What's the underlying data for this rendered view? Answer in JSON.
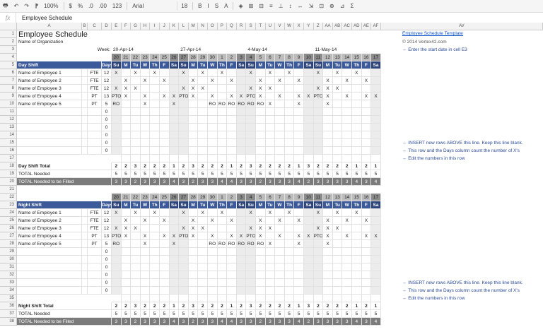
{
  "toolbar": {
    "items": [
      "🖶",
      "↶",
      "↷",
      "⁋",
      "100%",
      "$",
      "%",
      ".0",
      ".00",
      "123",
      "Arial",
      "18",
      "B",
      "I",
      "S",
      "A",
      "◈",
      "⊞",
      "⊟",
      "≡",
      "⊥",
      "↕",
      "↔",
      "⇲",
      "⊡",
      "⊕",
      "⊿",
      "Σ"
    ],
    "zoom": "100%",
    "font": "Arial",
    "font_size": "18"
  },
  "formula": {
    "fx": "fx",
    "value": "Employee Schedule"
  },
  "columns": [
    "A",
    "B",
    "C",
    "D",
    "E",
    "F",
    "G",
    "H",
    "I",
    "J",
    "K",
    "L",
    "M",
    "N",
    "O",
    "P",
    "Q",
    "R",
    "S",
    "T",
    "U",
    "V",
    "W",
    "X",
    "Y",
    "Z",
    "AA",
    "AB",
    "AC",
    "AD",
    "AE",
    "AF",
    "AV"
  ],
  "title": "Employee Schedule",
  "org": "Name of Organization",
  "week_label": "Week:",
  "weeks": [
    "20-Apr-14",
    "27-Apr-14",
    "4-May-14",
    "11-May-14"
  ],
  "dates": [
    "20",
    "21",
    "22",
    "23",
    "24",
    "25",
    "26",
    "27",
    "28",
    "29",
    "30",
    "1",
    "2",
    "3",
    "4",
    "5",
    "6",
    "7",
    "8",
    "9",
    "10",
    "11",
    "12",
    "13",
    "14",
    "15",
    "16",
    "17"
  ],
  "days": [
    "Su",
    "M",
    "Tu",
    "W",
    "Th",
    "F",
    "Sa",
    "Su",
    "M",
    "Tu",
    "W",
    "Th",
    "F",
    "Sa",
    "Su",
    "M",
    "Tu",
    "W",
    "Th",
    "F",
    "Sa",
    "Su",
    "M",
    "Tu",
    "W",
    "Th",
    "F",
    "Sa"
  ],
  "day_shift": {
    "label": "Day Shift",
    "days_hdr": "Days",
    "employees": [
      {
        "name": "Name of Employee 1",
        "type": "FTE",
        "days": "12",
        "marks": [
          "X",
          "",
          "X",
          "",
          "X",
          "",
          "",
          "X",
          "",
          "X",
          "",
          "X",
          "",
          "",
          "X",
          "",
          "X",
          "",
          "X",
          "",
          "",
          "X",
          "",
          "X",
          "",
          "X",
          "",
          ""
        ]
      },
      {
        "name": "Name of Employee 2",
        "type": "FTE",
        "days": "12",
        "marks": [
          "",
          "X",
          "",
          "X",
          "",
          "X",
          "",
          "",
          "X",
          "",
          "X",
          "",
          "X",
          "",
          "",
          "X",
          "",
          "X",
          "",
          "X",
          "",
          "",
          "X",
          "",
          "X",
          "",
          "X",
          ""
        ]
      },
      {
        "name": "Name of Employee 3",
        "type": "FTE",
        "days": "12",
        "marks": [
          "X",
          "X",
          "X",
          "",
          "",
          "",
          "",
          "X",
          "X",
          "X",
          "",
          "",
          "",
          "",
          "X",
          "X",
          "X",
          "",
          "",
          "",
          "",
          "X",
          "X",
          "X",
          "",
          "",
          "",
          ""
        ]
      },
      {
        "name": "Name of Employee 4",
        "type": "PT",
        "days": "13",
        "marks": [
          "PTO",
          "X",
          "",
          "X",
          "",
          "X",
          "X",
          "PTO",
          "X",
          "",
          "X",
          "",
          "X",
          "X",
          "PTO",
          "X",
          "",
          "X",
          "",
          "X",
          "X",
          "PTO",
          "X",
          "",
          "X",
          "",
          "X",
          "X"
        ]
      },
      {
        "name": "Name of Employee 5",
        "type": "PT",
        "days": "5",
        "marks": [
          "RO",
          "",
          "",
          "X",
          "",
          "",
          "X",
          "",
          "",
          "",
          "RO",
          "RO",
          "RO",
          "RO",
          "RO",
          "RO",
          "X",
          "",
          "",
          "X",
          "",
          "",
          "X",
          "",
          "",
          "",
          "",
          ""
        ]
      }
    ],
    "empty_days": [
      "0",
      "0",
      "0",
      "0",
      "0",
      "0"
    ],
    "total_label": "Day Shift Total",
    "total": [
      "2",
      "2",
      "3",
      "2",
      "2",
      "2",
      "1",
      "2",
      "3",
      "2",
      "2",
      "2",
      "1",
      "2",
      "3",
      "2",
      "2",
      "2",
      "2",
      "1",
      "3",
      "2",
      "2",
      "2",
      "2",
      "1",
      "2",
      "1"
    ],
    "needed_label": "TOTAL Needed",
    "needed": [
      "5",
      "5",
      "5",
      "5",
      "5",
      "5",
      "5",
      "5",
      "5",
      "5",
      "5",
      "5",
      "5",
      "5",
      "5",
      "5",
      "5",
      "5",
      "5",
      "5",
      "5",
      "5",
      "5",
      "5",
      "5",
      "5",
      "5",
      "5"
    ],
    "filled_label": "TOTAL Needed to be Filled",
    "filled": [
      "3",
      "3",
      "2",
      "3",
      "3",
      "3",
      "4",
      "3",
      "2",
      "3",
      "3",
      "4",
      "4",
      "3",
      "3",
      "2",
      "3",
      "3",
      "3",
      "4",
      "2",
      "3",
      "3",
      "3",
      "3",
      "4",
      "3",
      "4"
    ]
  },
  "night_shift": {
    "label": "Night Shift",
    "days_hdr": "Days",
    "employees": [
      {
        "name": "Name of Employee 1",
        "type": "FTE",
        "days": "12",
        "marks": [
          "X",
          "",
          "X",
          "",
          "X",
          "",
          "",
          "X",
          "",
          "X",
          "",
          "X",
          "",
          "",
          "X",
          "",
          "X",
          "",
          "X",
          "",
          "",
          "X",
          "",
          "X",
          "",
          "X",
          "",
          ""
        ]
      },
      {
        "name": "Name of Employee 2",
        "type": "FTE",
        "days": "12",
        "marks": [
          "",
          "X",
          "",
          "X",
          "",
          "X",
          "",
          "",
          "X",
          "",
          "X",
          "",
          "X",
          "",
          "",
          "X",
          "",
          "X",
          "",
          "X",
          "",
          "",
          "X",
          "",
          "X",
          "",
          "X",
          ""
        ]
      },
      {
        "name": "Name of Employee 3",
        "type": "FTE",
        "days": "12",
        "marks": [
          "X",
          "X",
          "X",
          "",
          "",
          "",
          "",
          "X",
          "X",
          "X",
          "",
          "",
          "",
          "",
          "X",
          "X",
          "X",
          "",
          "",
          "",
          "",
          "X",
          "X",
          "X",
          "",
          "",
          "",
          ""
        ]
      },
      {
        "name": "Name of Employee 4",
        "type": "PT",
        "days": "13",
        "marks": [
          "PTO",
          "X",
          "",
          "X",
          "",
          "X",
          "X",
          "PTO",
          "X",
          "",
          "X",
          "",
          "X",
          "X",
          "PTO",
          "X",
          "",
          "X",
          "",
          "X",
          "X",
          "PTO",
          "X",
          "",
          "X",
          "",
          "X",
          "X"
        ]
      },
      {
        "name": "Name of Employee 5",
        "type": "PT",
        "days": "5",
        "marks": [
          "RO",
          "",
          "",
          "X",
          "",
          "",
          "X",
          "",
          "",
          "",
          "RO",
          "RO",
          "RO",
          "RO",
          "RO",
          "RO",
          "X",
          "",
          "",
          "X",
          "",
          "",
          "X",
          "",
          "",
          "",
          "",
          ""
        ]
      }
    ],
    "empty_days": [
      "0",
      "0",
      "0",
      "0",
      "0",
      "0"
    ],
    "total_label": "Night Shift Total",
    "total": [
      "2",
      "2",
      "3",
      "2",
      "2",
      "2",
      "1",
      "2",
      "3",
      "2",
      "2",
      "2",
      "1",
      "2",
      "3",
      "2",
      "2",
      "2",
      "2",
      "1",
      "3",
      "2",
      "2",
      "2",
      "2",
      "1",
      "2",
      "1"
    ],
    "needed_label": "TOTAL Needed",
    "needed": [
      "5",
      "5",
      "5",
      "5",
      "5",
      "5",
      "5",
      "5",
      "5",
      "5",
      "5",
      "5",
      "5",
      "5",
      "5",
      "5",
      "5",
      "5",
      "5",
      "5",
      "5",
      "5",
      "5",
      "5",
      "5",
      "5",
      "5",
      "5"
    ],
    "filled_label": "TOTAL Needed to be Filled",
    "filled": [
      "3",
      "3",
      "2",
      "3",
      "3",
      "3",
      "4",
      "3",
      "2",
      "3",
      "3",
      "4",
      "4",
      "3",
      "3",
      "2",
      "3",
      "3",
      "3",
      "4",
      "2",
      "3",
      "3",
      "3",
      "3",
      "4",
      "3",
      "4"
    ]
  },
  "notes": {
    "template_link": "Employee Schedule Template",
    "copyright": "© 2014 Vertex42.com",
    "start_date": "← Enter the start date in cell E3",
    "insert_rows": "← INSERT new rows ABOVE this line. Keep this line blank.",
    "count_x": "← This row and the Days column count the number of X's",
    "edit_numbers": "← Edit the numbers in this row"
  }
}
